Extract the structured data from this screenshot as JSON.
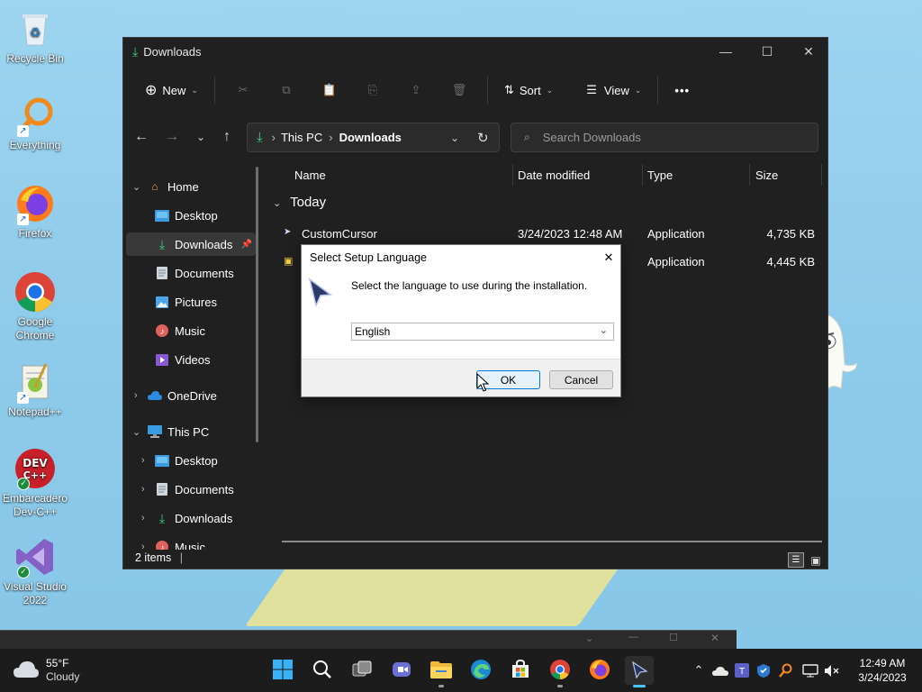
{
  "desktop": {
    "icons": [
      {
        "label": "Recycle Bin",
        "icon": "recycle-bin-icon"
      },
      {
        "label": "Everything",
        "icon": "everything-search-icon"
      },
      {
        "label": "Firefox",
        "icon": "firefox-icon"
      },
      {
        "label": "Google Chrome",
        "icon": "chrome-icon"
      },
      {
        "label": "Notepad++",
        "icon": "notepadpp-icon"
      },
      {
        "label": "Embarcadero Dev-C++",
        "icon": "devcpp-icon"
      },
      {
        "label": "Visual Studio 2022",
        "icon": "visual-studio-icon"
      }
    ]
  },
  "explorer": {
    "title": "Downloads",
    "toolbar": {
      "new_label": "New",
      "sort_label": "Sort",
      "view_label": "View",
      "more_label": "•••"
    },
    "address": {
      "root": "This PC",
      "current": "Downloads"
    },
    "search_placeholder": "Search Downloads",
    "sidebar": [
      {
        "label": "Home",
        "icon": "home-icon"
      },
      {
        "label": "Desktop",
        "icon": "desktop-folder-icon"
      },
      {
        "label": "Downloads",
        "icon": "downloads-icon"
      },
      {
        "label": "Documents",
        "icon": "documents-icon"
      },
      {
        "label": "Pictures",
        "icon": "pictures-icon"
      },
      {
        "label": "Music",
        "icon": "music-icon"
      },
      {
        "label": "Videos",
        "icon": "videos-icon"
      },
      {
        "label": "OneDrive",
        "icon": "onedrive-icon"
      },
      {
        "label": "This PC",
        "icon": "this-pc-icon"
      },
      {
        "label": "Desktop",
        "icon": "desktop-folder-icon"
      },
      {
        "label": "Documents",
        "icon": "documents-icon"
      },
      {
        "label": "Downloads",
        "icon": "downloads-icon"
      },
      {
        "label": "Music",
        "icon": "music-icon"
      }
    ],
    "columns": {
      "name": "Name",
      "date": "Date modified",
      "type": "Type",
      "size": "Size"
    },
    "group_label": "Today",
    "files": [
      {
        "name": "CustomCursor",
        "date": "3/24/2023 12:48 AM",
        "type": "Application",
        "size": "4,735 KB"
      },
      {
        "name": "",
        "date": "",
        "type": "Application",
        "size": "4,445 KB"
      }
    ],
    "status": "2 items"
  },
  "dialog": {
    "title": "Select Setup Language",
    "message": "Select the language to use during the installation.",
    "selected_language": "English",
    "ok_label": "OK",
    "cancel_label": "Cancel",
    "close_glyph": "✕"
  },
  "taskbar": {
    "weather": {
      "temp": "55°F",
      "condition": "Cloudy"
    },
    "clock": {
      "time": "12:49 AM",
      "date": "3/24/2023"
    }
  },
  "colors": {
    "accent": "#0078d7",
    "explorer_bg": "#202020",
    "taskbar_bg": "#1c1c1c"
  }
}
